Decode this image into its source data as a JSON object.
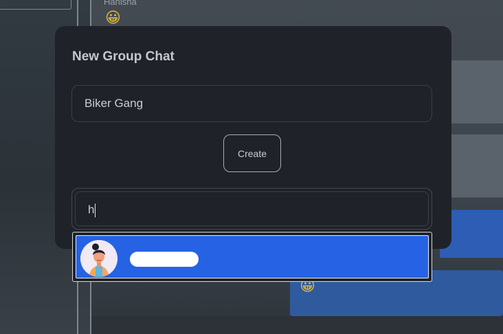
{
  "background": {
    "sender_name": "Hanisha",
    "emoji": "😀"
  },
  "modal": {
    "title": "New Group Chat",
    "group_name_value": "Biker Gang",
    "create_label": "Create",
    "search_value": "h"
  },
  "results": [
    {
      "name": "",
      "avatar_icon": "avatar-woman-icon",
      "highlighted": true
    }
  ],
  "colors": {
    "modal_bg": "#1f2329",
    "highlight": "#2563e4",
    "text": "#c9ced3"
  }
}
